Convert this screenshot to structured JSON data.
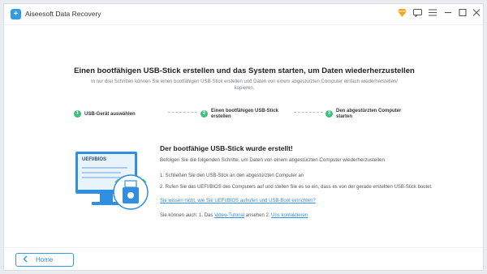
{
  "app": {
    "title": "Aiseesoft Data Recovery",
    "logo_glyph": "+",
    "icons": [
      "gem-icon",
      "chat-icon",
      "menu-icon",
      "minimize-icon",
      "maximize-icon",
      "close-icon"
    ],
    "accent_color": "#2f9de4"
  },
  "header": {
    "title": "Einen bootfähigen USB-Stick erstellen und das System starten, um Daten wiederherzustellen",
    "subtitle": "In nur drei Schritten können Sie einen bootfähigen USB-Stick erstellen und Daten von einem abgestürzten Computer einfach wiederherstellen/ kopieren."
  },
  "steps": [
    {
      "number": "1",
      "label": "USB-Gerät auswählen",
      "color": "#3cc07e"
    },
    {
      "number": "2",
      "label": "Einen bootfähigen USB-Stick erstellen",
      "color": "#3cc07e"
    },
    {
      "number": "3",
      "label": "Den abgestürzten Computer starten",
      "color": "#3cc07e"
    }
  ],
  "illustration": {
    "screen_label": "UEFI/BIOS"
  },
  "result": {
    "title": "Der bootfähige USB-Stick wurde erstellt!",
    "subtitle": "Befolgen Sie die folgenden Schritte, um Daten von einem abgestürzten Computer wiederherzustellen",
    "instruction_1": "1. Schließen Sie den USB-Stick an den abgestürzten Computer an",
    "instruction_2": "2. Rufen Sie das UEFI/BIOS des Computers auf und stellen Sie es so ein, dass es von der gerade erstellten USB-Stick bootet.",
    "bios_link": "Sie wissen nicht, wie Sie UEFI/BIOS aufrufen und USB-Boot einrichten?",
    "also_prefix": "Sie können auch: 1. Das",
    "video_link": "Video-Tutorial",
    "also_middle": "ansehen 2.",
    "contact_link": "Uns kontaktieren"
  },
  "footer": {
    "home_label": "Home"
  }
}
